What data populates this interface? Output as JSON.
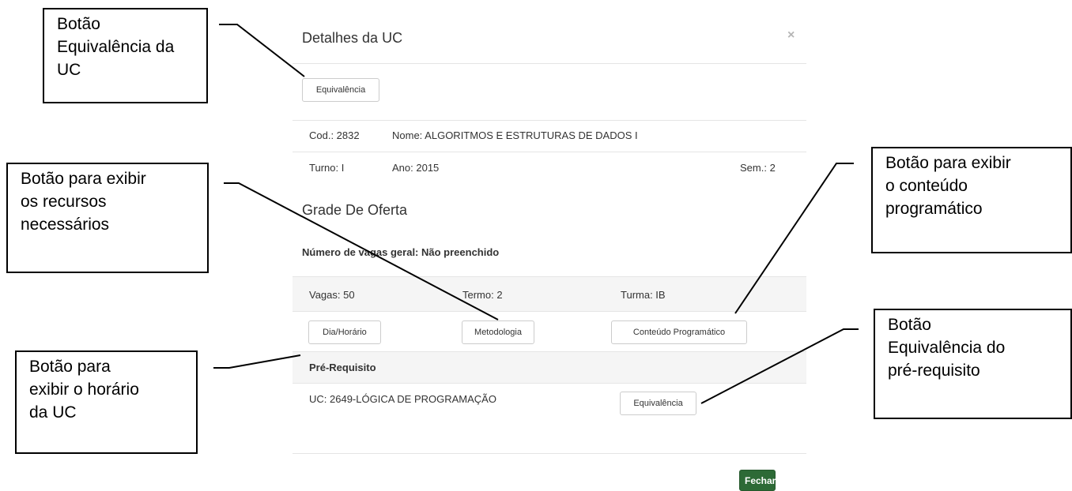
{
  "modal": {
    "title": "Detalhes da UC",
    "close_glyph": "×",
    "equivalence_button": "Equivalência",
    "info": {
      "cod": "Cod.: 2832",
      "nome": "Nome: ALGORITMOS E ESTRUTURAS DE DADOS I",
      "turno": "Turno: I",
      "ano": "Ano: 2015",
      "sem": "Sem.: 2"
    },
    "grade_title": "Grade De Oferta",
    "vagas_geral": "Número de vagas geral: Não preenchido",
    "offer": {
      "vagas": "Vagas: 50",
      "termo": "Termo: 2",
      "turma": "Turma: IB"
    },
    "buttons": {
      "dia_horario": "Dia/Horário",
      "metodologia": "Metodologia",
      "conteudo": "Conteúdo Programático"
    },
    "prereq": {
      "header": "Pré-Requisito",
      "item": "UC: 2649-LÓGICA DE PROGRAMAÇÃO",
      "equivalence_button": "Equivalência"
    },
    "close_button": "Fechar"
  },
  "callouts": {
    "equiv_uc": "Botão\nEquivalência da\nUC",
    "recursos": "Botão para exibir\nos recursos\nnecessários",
    "horario": "Botão para\nexibir o horário\nda UC",
    "conteudo": "Botão para exibir\no conteúdo\nprogramático",
    "equiv_prereq": "Botão\nEquivalência do\npré-requisito"
  },
  "colors": {
    "primary_button": "#2d6a36",
    "stripe": "#f5f5f5",
    "divider": "#e5e5e5"
  }
}
